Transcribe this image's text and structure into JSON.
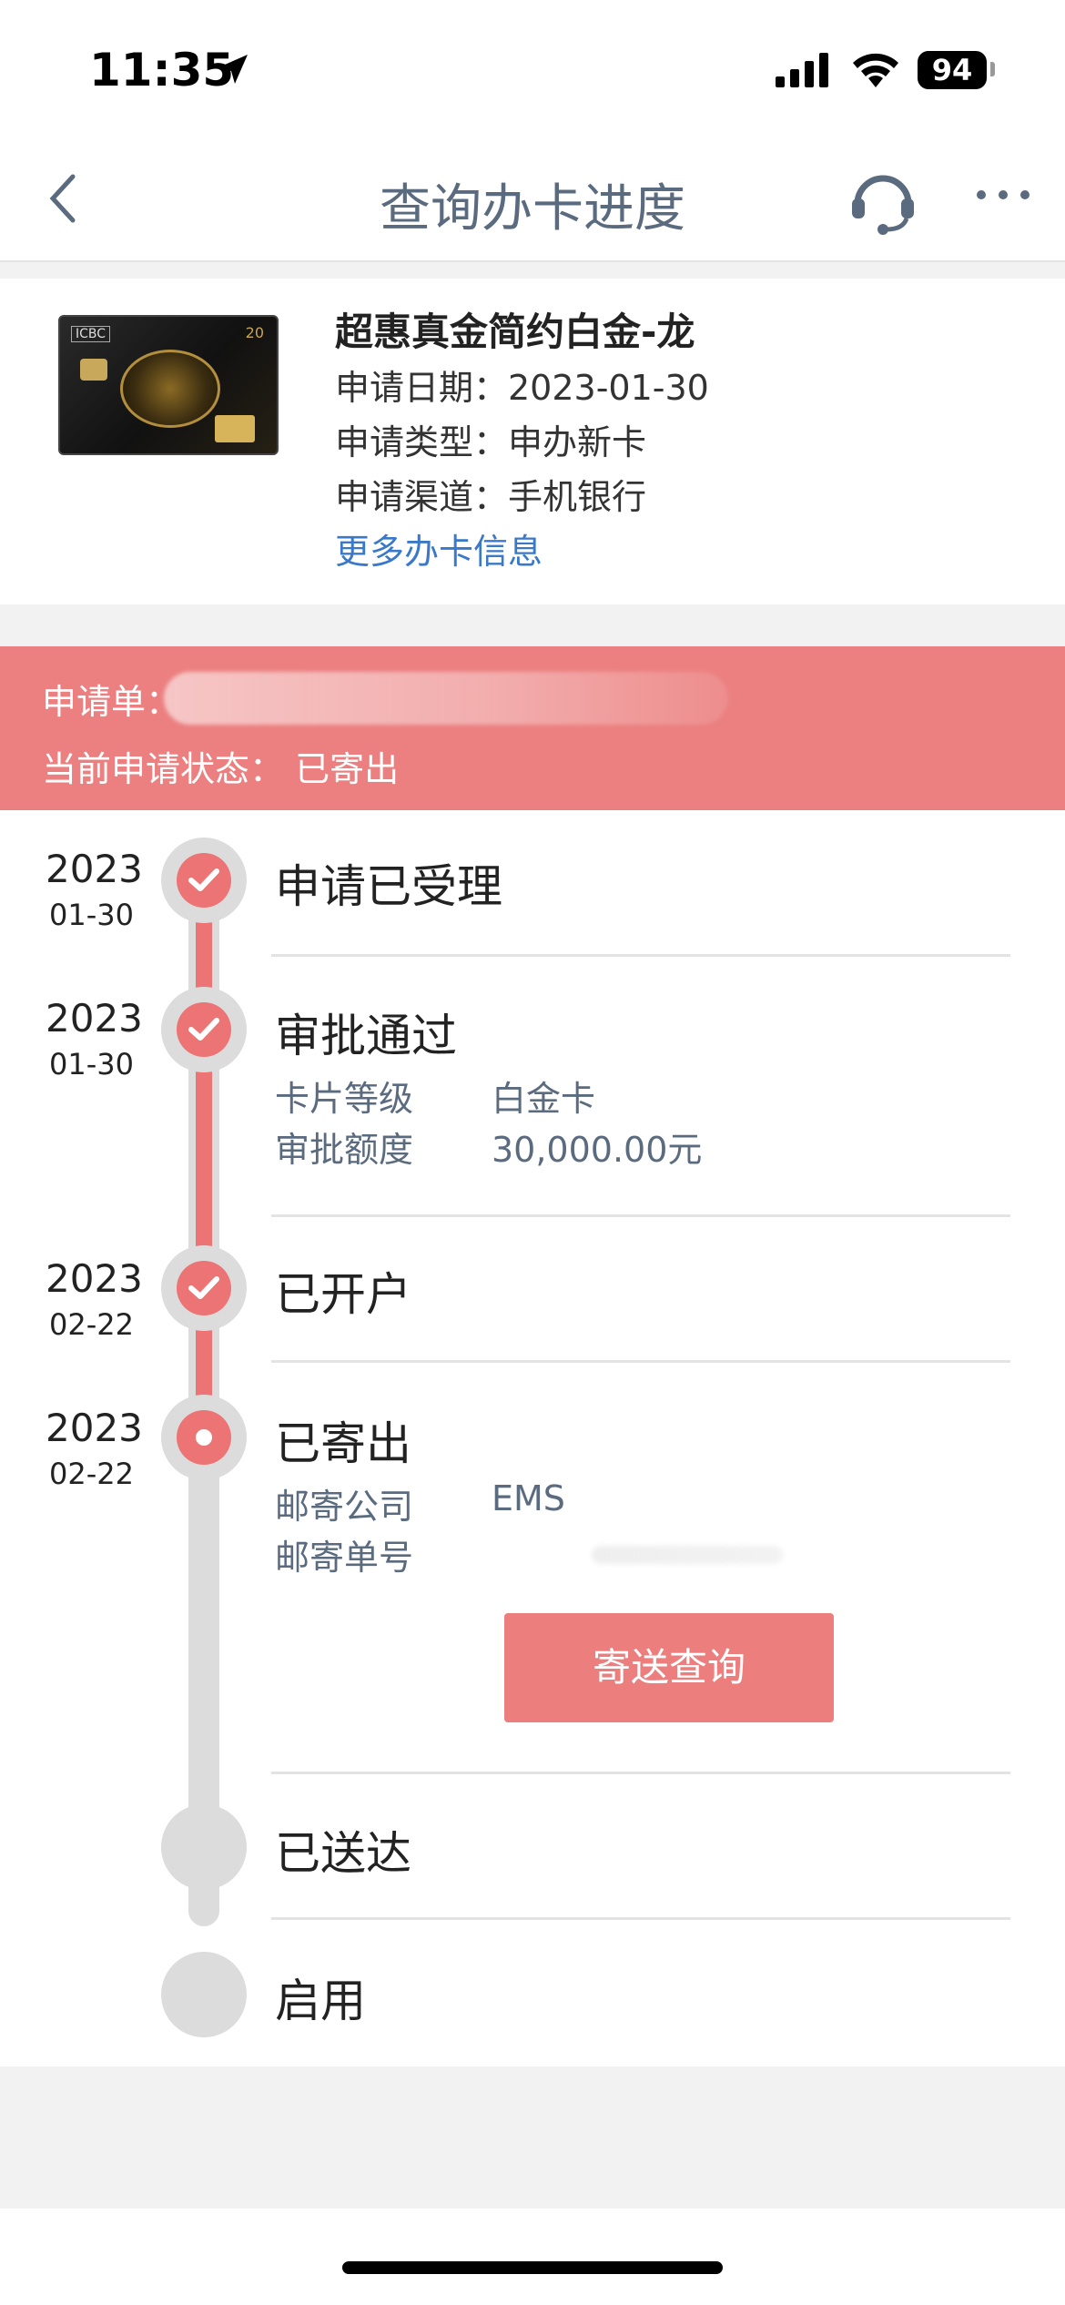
{
  "status_bar": {
    "time": "11:35",
    "battery": "94"
  },
  "nav": {
    "title": "查询办卡进度"
  },
  "card": {
    "name": "超惠真金简约白金-龙",
    "apply_date": "申请日期：2023-01-30",
    "apply_type": "申请类型：申办新卡",
    "apply_channel": "申请渠道：手机银行",
    "more_link": "更多办卡信息",
    "image_logo_text": "ICBC",
    "image_number": "20"
  },
  "application": {
    "order_label": "申请单：",
    "status_line": "当前申请状态：  已寄出"
  },
  "timeline": {
    "steps": [
      {
        "year": "2023",
        "day": "01-30",
        "title": "申请已受理"
      },
      {
        "year": "2023",
        "day": "01-30",
        "title": "审批通过",
        "details": [
          {
            "label": "卡片等级",
            "value": "白金卡"
          },
          {
            "label": "审批额度",
            "value": "30,000.00元"
          }
        ]
      },
      {
        "year": "2023",
        "day": "02-22",
        "title": "已开户"
      },
      {
        "year": "2023",
        "day": "02-22",
        "title": "已寄出",
        "details": [
          {
            "label": "邮寄公司",
            "value": "EMS"
          },
          {
            "label": "邮寄单号",
            "value": ""
          }
        ],
        "button": "寄送查询"
      },
      {
        "title": "已送达"
      },
      {
        "title": "启用"
      }
    ]
  },
  "colors": {
    "accent": "#ec7474",
    "link": "#3a78c9",
    "muted": "#5b6b7f"
  },
  "icons": [
    "location-arrow-icon",
    "signal-icon",
    "wifi-icon",
    "back-chevron-icon",
    "headset-icon",
    "more-dots-icon",
    "check-icon"
  ]
}
